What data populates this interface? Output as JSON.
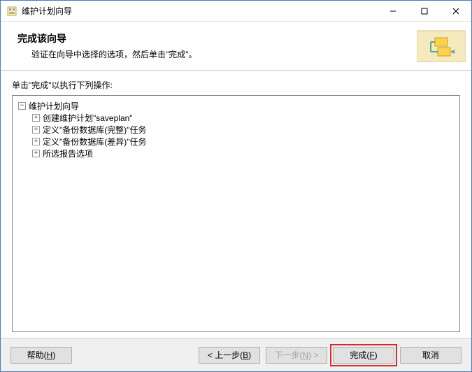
{
  "window": {
    "title": "维护计划向导"
  },
  "header": {
    "title": "完成该向导",
    "subtitle": "验证在向导中选择的选项，然后单击\"完成\"。"
  },
  "instruction": "单击\"完成\"以执行下列操作:",
  "tree": {
    "root": "维护计划向导",
    "children": [
      "创建维护计划\"saveplan\"",
      "定义\"备份数据库(完整)\"任务",
      "定义\"备份数据库(差异)\"任务",
      "所选报告选项"
    ]
  },
  "buttons": {
    "help": "帮助(",
    "help_key": "H",
    "help_suffix": ")",
    "back": "< 上一步(",
    "back_key": "B",
    "back_suffix": ")",
    "next": "下一步(",
    "next_key": "N",
    "next_suffix": ") >",
    "finish": "完成(",
    "finish_key": "F",
    "finish_suffix": ")",
    "cancel": "取消"
  }
}
